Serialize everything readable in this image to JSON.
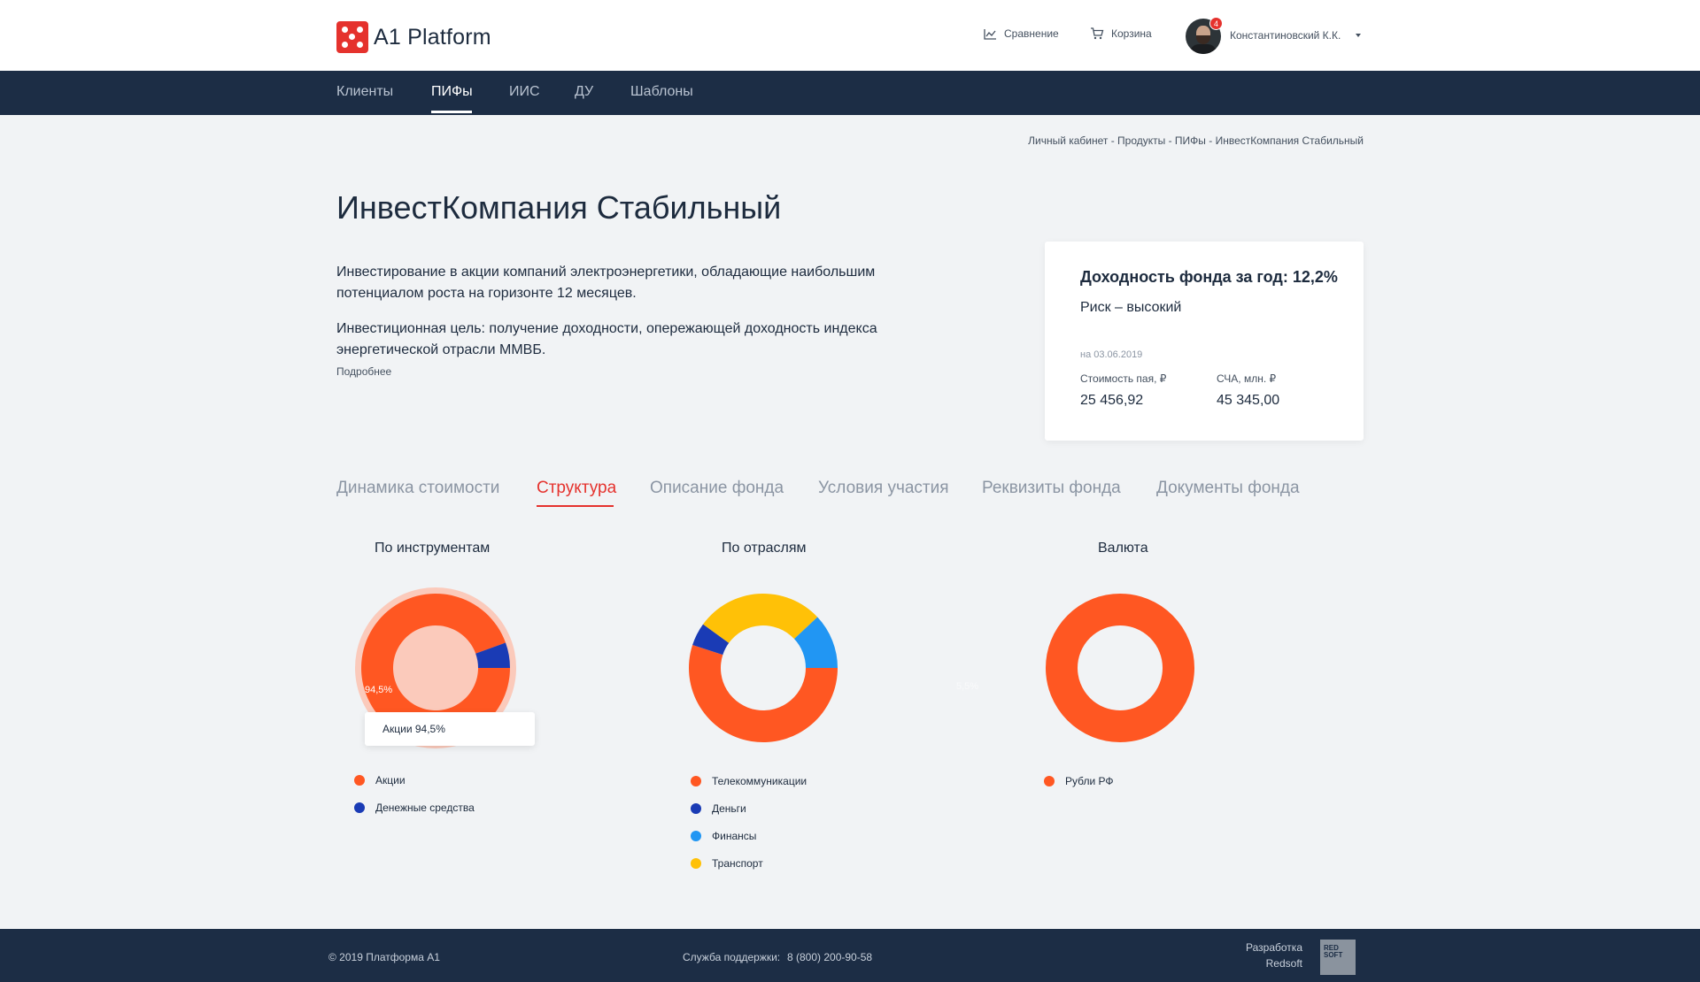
{
  "app": {
    "name": "A1 Platform"
  },
  "header": {
    "compare_label": "Сравнение",
    "cart_label": "Корзина",
    "user_name": "Константиновский К.К.",
    "notifications_count": "4"
  },
  "nav": {
    "items": [
      {
        "label": "Клиенты"
      },
      {
        "label": "ПИФы",
        "active": true
      },
      {
        "label": "ИИС"
      },
      {
        "label": "ДУ"
      },
      {
        "label": "Шаблоны"
      }
    ]
  },
  "breadcrumb": "Личный кабинет - Продукты - ПИФы - ИнвестКомпания Стабильный",
  "fund": {
    "title": "ИнвестКомпания Стабильный",
    "description_1": "Инвестирование в акции компаний электроэнергетики, обладающие наибольшим потенциалом роста на горизонте 12 месяцев.",
    "description_2": "Инвестиционная цель: получение доходности, опережающей доходность индекса энергетической отрасли ММВБ.",
    "more_link": "Подробнее"
  },
  "card": {
    "yield": "Доходность фонда за год: 12,2%",
    "risk": "Риск – высокий",
    "date": "на 03.06.2019",
    "share_price_label": "Стоимость пая, ₽",
    "share_price_value": "25 456,92",
    "nav_label": "СЧА, млн. ₽",
    "nav_value": "45 345,00"
  },
  "tabs": [
    {
      "label": "Динамика стоимости"
    },
    {
      "label": "Структура",
      "active": true
    },
    {
      "label": "Описание фонда"
    },
    {
      "label": "Условия участия"
    },
    {
      "label": "Реквизиты фонда"
    },
    {
      "label": "Документы фонда"
    }
  ],
  "colors": {
    "orange": "#ff5722",
    "blue": "#1a3bb5",
    "light_blue": "#2196f3",
    "yellow": "#ffc107",
    "accent_red": "#e5322d",
    "navy": "#1c2d45"
  },
  "chart_data": [
    {
      "type": "pie",
      "title": "По инструментам",
      "categories": [
        "Акции",
        "Денежные средства"
      ],
      "values": [
        94.5,
        5.5
      ],
      "colors": [
        "#ff5722",
        "#1a3bb5"
      ],
      "slice_label": "94,5%",
      "tooltip": "Акции 94,5%",
      "ghost_label": "5,5%"
    },
    {
      "type": "pie",
      "title": "По отраслям",
      "categories": [
        "Телекоммуникации",
        "Деньги",
        "Финансы",
        "Транспорт"
      ],
      "values": [
        55,
        5,
        12,
        28
      ],
      "colors": [
        "#ff5722",
        "#1a3bb5",
        "#2196f3",
        "#ffc107"
      ]
    },
    {
      "type": "pie",
      "title": "Валюта",
      "categories": [
        "Рубли РФ"
      ],
      "values": [
        100
      ],
      "colors": [
        "#ff5722"
      ]
    }
  ],
  "footer": {
    "copyright": "© 2019  Платформа А1",
    "support_label": "Служба поддержки:",
    "support_phone": "8 (800) 200-90-58",
    "dev_label_1": "Разработка",
    "dev_label_2": "Redsoft",
    "dev_logo_1": "RED",
    "dev_logo_2": "SOFT"
  }
}
